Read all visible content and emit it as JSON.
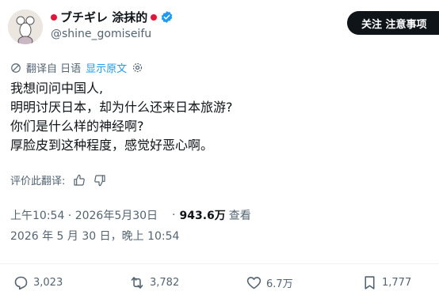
{
  "author": {
    "display_name": "ブチギレ 涂抹的",
    "handle": "@shine_gomiseifu",
    "verified_icon": "verified-badge-icon",
    "follow_label": "关注 注意事项"
  },
  "translation": {
    "label": "翻译自 日语",
    "show_original": "显示原文"
  },
  "tweet": {
    "lines": [
      "我想问问中国人,",
      "明明讨厌日本，却为什么还来日本旅游?",
      "你们是什么样的神经啊?",
      "厚脸皮到这种程度，感觉好恶心啊。"
    ]
  },
  "rate_translation": {
    "label": "评价此翻译:"
  },
  "meta": {
    "time": "上午10:54 · 2026年5月30日",
    "sep": "·",
    "views": "943.6万",
    "views_label": "查看",
    "translated_time": "2026 年 5 月 30 日，晚上 10:54"
  },
  "actions": {
    "replies": "3,023",
    "reposts": "3,782",
    "likes": "6.7万",
    "bookmarks": "1,777"
  },
  "colors": {
    "accent": "#1d9bf0",
    "text": "#0f1419",
    "muted": "#536471",
    "flag_red": "#e0163b"
  }
}
